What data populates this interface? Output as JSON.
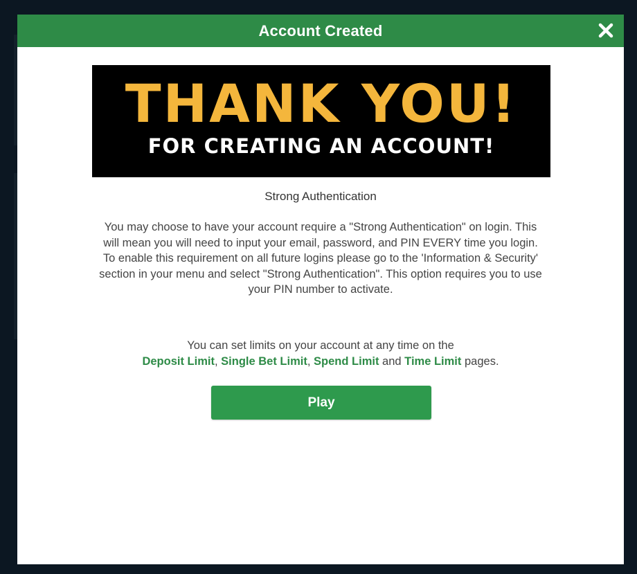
{
  "modal": {
    "title": "Account Created",
    "close_icon": "close-icon"
  },
  "banner": {
    "headline": "THANK YOU!",
    "subline": "FOR CREATING AN ACCOUNT!"
  },
  "auth": {
    "heading": "Strong Authentication",
    "body": "You may choose to have your account require a \"Strong Authentication\" on login. This will mean you will need to input your email, password, and PIN EVERY time you login. To enable this requirement on all future logins please go to the 'Information & Security' section in your menu and select \"Strong Authentication\". This option requires you to use your PIN number to activate."
  },
  "limits": {
    "intro": "You can set limits on your account at any time on the",
    "deposit_limit": "Deposit Limit",
    "sep1": ",",
    "single_bet_limit": "Single Bet Limit",
    "sep2": ",",
    "spend_limit": "Spend Limit",
    "and_word": "and",
    "time_limit": "Time Limit",
    "suffix": "pages."
  },
  "play_button": {
    "label": "Play"
  },
  "colors": {
    "brand_green": "#2e8b47",
    "banner_gold": "#f4b63c",
    "backdrop": "#0c1722"
  }
}
